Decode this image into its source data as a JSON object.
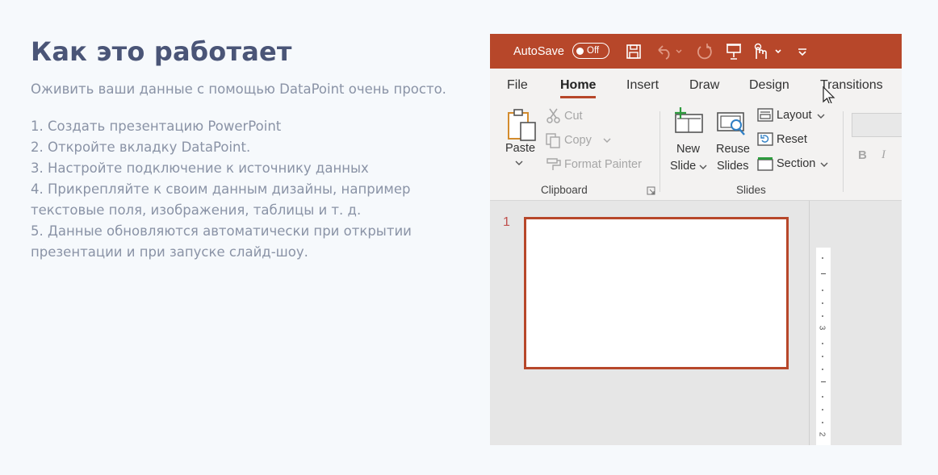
{
  "section": {
    "title": "Как это работает",
    "lead": "Оживить ваши данные с помощью DataPoint очень просто.",
    "steps": [
      "1. Создать презентацию PowerPoint",
      "2. Откройте вкладку DataPoint.",
      "3. Настройте подключение к источнику данных",
      "4. Прикрепляйте к своим данным дизайны, например текстовые поля, изображения, таблицы и т. д.",
      "5. Данные обновляются автоматически при открытии презентации и при запуске слайд-шоу."
    ]
  },
  "ppt": {
    "autosave_label": "AutoSave",
    "autosave_state": "Off",
    "tabs": [
      "File",
      "Home",
      "Insert",
      "Draw",
      "Design",
      "Transitions"
    ],
    "active_tab": "Home",
    "clipboard": {
      "paste": "Paste",
      "cut": "Cut",
      "copy": "Copy",
      "format_painter": "Format Painter",
      "group_label": "Clipboard"
    },
    "slides": {
      "new_slide_1": "New",
      "new_slide_2": "Slide",
      "reuse_1": "Reuse",
      "reuse_2": "Slides",
      "layout": "Layout",
      "reset": "Reset",
      "section": "Section",
      "group_label": "Slides"
    },
    "font": {
      "bold": "B",
      "italic": "I"
    },
    "thumbnail_number": "1",
    "ruler_labels": [
      "3",
      "2"
    ],
    "colors": {
      "accent": "#b7472a",
      "text_title": "#4a5577",
      "text_body": "#8a93a6"
    }
  }
}
